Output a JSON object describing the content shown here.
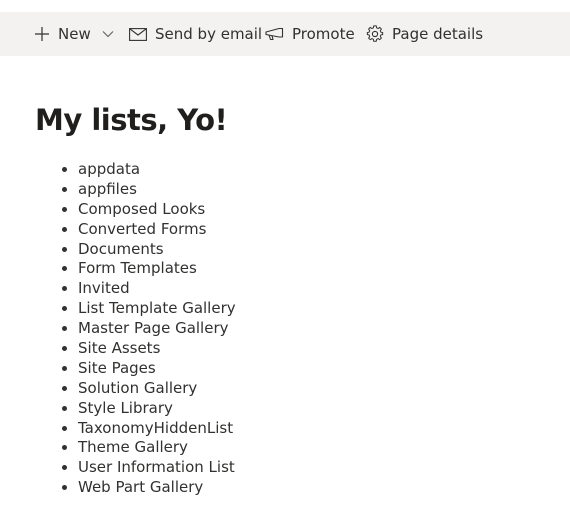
{
  "toolbar": {
    "new_label": "New",
    "send_label": "Send by email",
    "promote_label": "Promote",
    "details_label": "Page details"
  },
  "page": {
    "title": "My lists, Yo!"
  },
  "lists": [
    "appdata",
    "appfiles",
    "Composed Looks",
    "Converted Forms",
    "Documents",
    "Form Templates",
    "Invited",
    "List Template Gallery",
    "Master Page Gallery",
    "Site Assets",
    "Site Pages",
    "Solution Gallery",
    "Style Library",
    "TaxonomyHiddenList",
    "Theme Gallery",
    "User Information List",
    "Web Part Gallery"
  ],
  "icons": {
    "new": "plus-icon",
    "new_menu": "chevron-down-icon",
    "send": "mail-icon",
    "promote": "megaphone-icon",
    "details": "gear-icon"
  },
  "colors": {
    "toolbar_bg": "#f3f2f1",
    "text": "#323130",
    "title": "#201f1e"
  }
}
